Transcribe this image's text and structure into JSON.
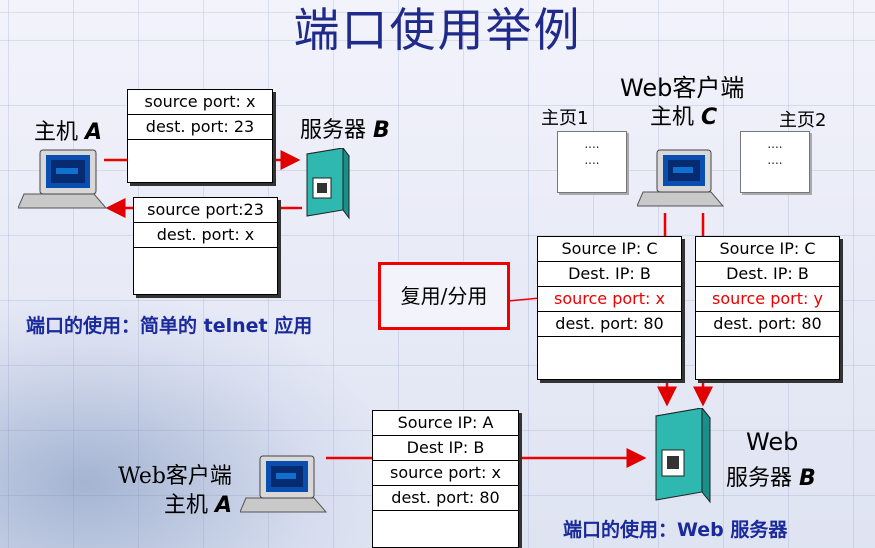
{
  "title": "端口使用举例",
  "host_a_top": {
    "prefix": "主机 ",
    "name": "A"
  },
  "server_b_top": {
    "prefix": "服务器 ",
    "name": "B"
  },
  "telnet_req": [
    "source port: x",
    "dest. port: 23"
  ],
  "telnet_resp": [
    "source port:23",
    "dest. port: x"
  ],
  "caption_telnet": "端口的使用：简单的 telnet 应用",
  "web_client_c": {
    "line1": "Web客户端",
    "prefix": "主机 ",
    "name": "C"
  },
  "page1_label": "主页1",
  "page2_label": "主页2",
  "mux_label": "复用/分用",
  "seg_c1": [
    "Source IP: C",
    "Dest. IP: B",
    "source port: x",
    "dest. port: 80"
  ],
  "seg_c2": [
    "Source IP: C",
    "Dest. IP: B",
    "source port: y",
    "dest. port: 80"
  ],
  "seg_a": [
    "Source IP: A",
    "Dest IP: B",
    "source port: x",
    "dest. port: 80"
  ],
  "web_client_a": {
    "line1": "Web客户端",
    "prefix": "主机 ",
    "name": "A"
  },
  "web_server_b": {
    "line1": "Web",
    "prefix": "服务器 ",
    "name": "B"
  },
  "caption_web": "端口的使用：Web 服务器",
  "page_dots": "....",
  "colors": {
    "title": "#1f2a8a",
    "caption": "#1a2a9a",
    "arrow": "#e00000",
    "server": "#2fb8b0"
  }
}
